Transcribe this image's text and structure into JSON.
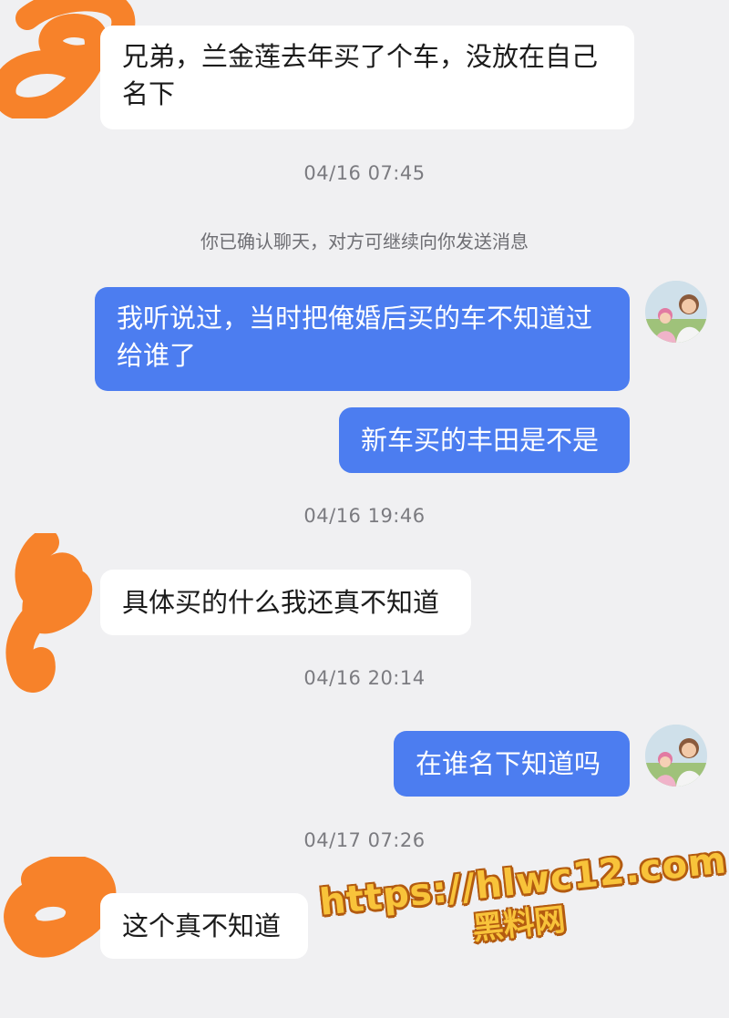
{
  "messages": [
    {
      "side": "in",
      "text": "兄弟，兰金莲去年买了个车，没放在自己名下"
    },
    {
      "side": "out",
      "text": "我听说过，当时把俺婚后买的车不知道过给谁了"
    },
    {
      "side": "out",
      "text": "新车买的丰田是不是"
    },
    {
      "side": "in",
      "text": "具体买的什么我还真不知道"
    },
    {
      "side": "out",
      "text": "在谁名下知道吗"
    },
    {
      "side": "in",
      "text": "这个真不知道"
    }
  ],
  "timestamps": [
    "04/16 07:45",
    "04/16 19:46",
    "04/16 20:14",
    "04/17 07:26"
  ],
  "system_notice": "你已确认聊天，对方可继续向你发送消息",
  "watermark": {
    "url": "https://hlwc12.com",
    "name": "黑料网"
  },
  "colors": {
    "background": "#f0f0f2",
    "outgoing_bubble": "#4c7df0",
    "incoming_bubble": "#ffffff",
    "redaction": "#f7822a",
    "watermark_fill": "#f8c33a"
  }
}
